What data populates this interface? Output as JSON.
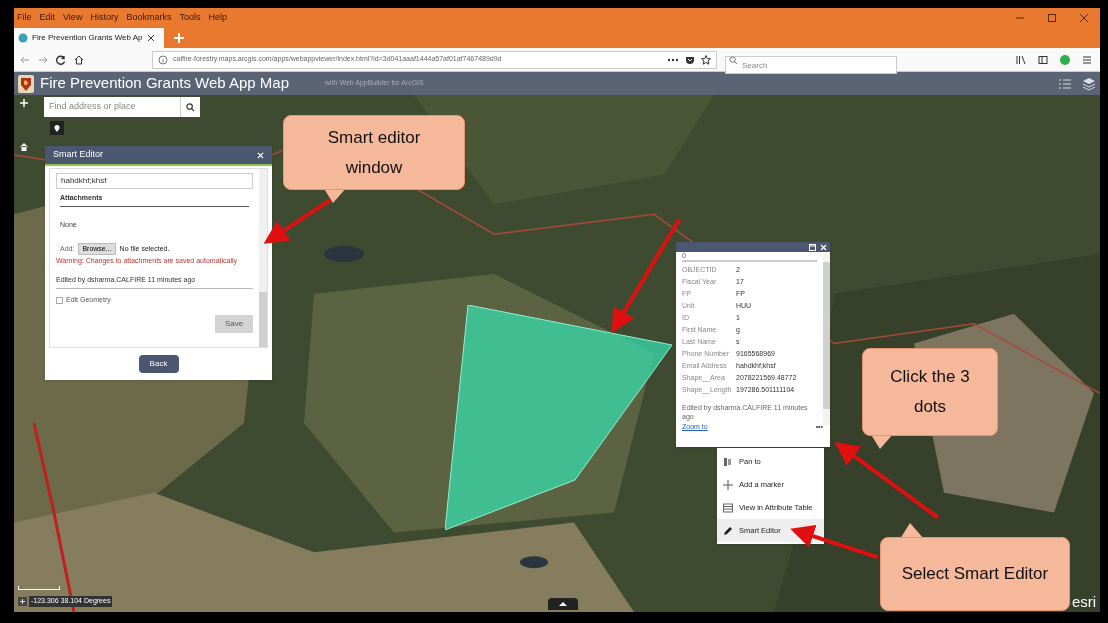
{
  "browser": {
    "menu": [
      "File",
      "Edit",
      "View",
      "History",
      "Bookmarks",
      "Tools",
      "Help"
    ],
    "tab": {
      "title": "Fire Prevention Grants Web Ap",
      "selected": true
    },
    "url": "calfire-forestry.maps.arcgis.com/apps/webappviewer/index.html?id=3d041aaaf1444a57af01af7467489d9d",
    "search_placeholder": "Search"
  },
  "app": {
    "title": "Fire Prevention Grants Web App Map",
    "subtitle": "with Web AppBuilder for ArcGIS",
    "search_placeholder": "Find address or place",
    "coordinates": "-123.306 38.104 Degrees",
    "logo": "esri"
  },
  "smart_editor": {
    "title": "Smart Editor",
    "field_value": "hahdkhf;khsf",
    "attachments_label": "Attachments",
    "attachments": "None",
    "add_label": "Add:",
    "browse": "Browse...",
    "no_file": "No file selected.",
    "warning": "Warning: Changes to attachments are saved automatically",
    "edited_by": "Edited by dsharma.CALFIRE 11 minutes ago",
    "edit_geometry": {
      "label": "Edit Geometry",
      "checked": false
    },
    "save": {
      "label": "Save",
      "disabled": true
    },
    "back": "Back"
  },
  "popup": {
    "title": "0",
    "fields": [
      {
        "name": "OBJECTID",
        "value": "2"
      },
      {
        "name": "Fiscal Year",
        "value": "17"
      },
      {
        "name": "FP",
        "value": "FP"
      },
      {
        "name": "Unit",
        "value": "HUU"
      },
      {
        "name": "ID",
        "value": "1"
      },
      {
        "name": "First Name",
        "value": "g"
      },
      {
        "name": "Last Name",
        "value": "s"
      },
      {
        "name": "Phone Number",
        "value": "9165568969"
      },
      {
        "name": "Email Address",
        "value": "hahdkhf;khsf"
      },
      {
        "name": "Shape__Area",
        "value": "2078221569.48772"
      },
      {
        "name": "Shape__Length",
        "value": "197286.501111104"
      }
    ],
    "edited_by": "Edited by dsharma.CALFIRE 11 minutes ago",
    "zoom_to": "Zoom to",
    "more": "•••"
  },
  "actions_menu": [
    {
      "kind": "pan",
      "label": "Pan to",
      "selected": false
    },
    {
      "kind": "marker",
      "label": "Add a marker",
      "selected": false
    },
    {
      "kind": "table",
      "label": "View in Attribute Table",
      "selected": false
    },
    {
      "kind": "edit",
      "label": "Smart Editor",
      "selected": true
    }
  ],
  "callouts": [
    {
      "text": "Smart editor window"
    },
    {
      "text": "Click the 3 dots"
    },
    {
      "text": "Select Smart Editor"
    }
  ]
}
